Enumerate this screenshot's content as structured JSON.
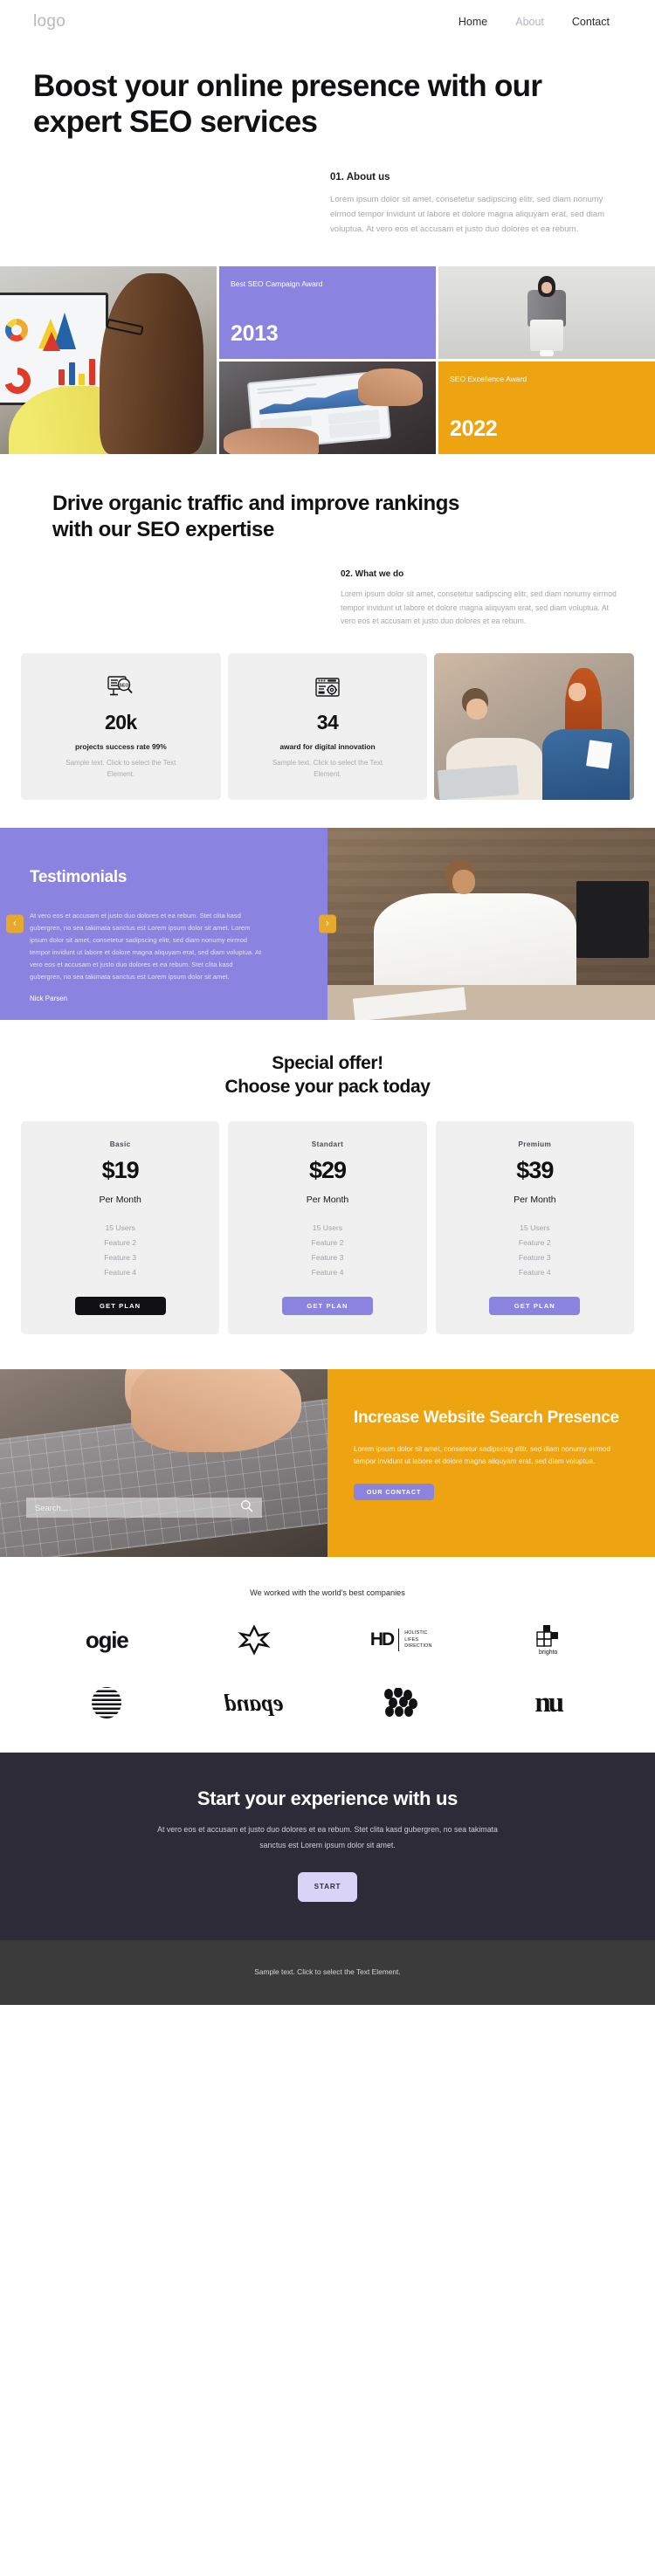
{
  "header": {
    "logo": "logo",
    "nav": [
      {
        "label": "Home",
        "dim": false
      },
      {
        "label": "About",
        "dim": true
      },
      {
        "label": "Contact",
        "dim": false
      }
    ]
  },
  "hero": {
    "heading": "Boost your online presence with our expert SEO services",
    "about_title": "01. About us",
    "about_text": "Lorem ipsum dolor sit amet, consetetur sadipscing elitr, sed diam nonumy eirmod tempor invidunt ut labore et dolore magna aliquyam erat, sed diam voluptua. At vero eos et accusam et justo duo dolores et ea rebum.",
    "awards": [
      {
        "title": "Best SEO Campaign Award",
        "year": "2013",
        "color": "#8b83e0"
      },
      {
        "title": "SEO Excellence Award",
        "year": "2022",
        "color": "#eda410"
      }
    ],
    "photos": [
      "woman-analyzing-charts-on-monitor-photo",
      "woman-standing-grey-jacket-photo",
      "hands-holding-tablet-dashboard-photo"
    ]
  },
  "services": {
    "heading": "Drive organic traffic and improve rankings with our SEO expertise",
    "what_title": "02. What we do",
    "what_text": "Lorem ipsum dolor sit amet, consetetur sadipscing elitr, sed diam nonumy eirmod tempor invidunt ut labore et dolore magna aliquyam erat, sed diam voluptua. At vero eos et accusam et justo duo dolores et ea rebum.",
    "stats": [
      {
        "icon": "seo-search-monitor-icon",
        "number": "20k",
        "label": "projects success rate 99%",
        "sub": "Sample text. Click to select the Text Element."
      },
      {
        "icon": "browser-gear-settings-icon",
        "number": "34",
        "label": "award for digital innovation",
        "sub": "Sample text. Click to select the Text Element."
      }
    ],
    "photo": "two-colleagues-with-laptop-photo"
  },
  "testimonials": {
    "heading": "Testimonials",
    "quote": "At vero eos et accusam et justo duo dolores et ea rebum. Stet clita kasd gubergren, no sea takimata sanctus est Lorem ipsum dolor sit amet. Lorem ipsum dolor sit amet, consetetur sadipscing elitr, sed diam nonumy eirmod tempor invidunt ut labore et dolore magna aliquyam erat, sed diam voluptua. At vero eos et accusam et justo duo dolores et ea rebum. Stet clita kasd gubergren, no sea takimata sanctus est Lorem ipsum dolor sit amet.",
    "author": "Nick Parsen",
    "prev": "‹",
    "next": "›",
    "photo": "man-drinking-coffee-at-desk-photo",
    "bg_color": "#8b83e0",
    "arrow_color": "#e6a92b"
  },
  "pricing": {
    "heading_line1": "Special offer!",
    "heading_line2": "Choose your pack today",
    "plans": [
      {
        "name": "Basic",
        "price": "$19",
        "period": "Per Month",
        "features": [
          "15 Users",
          "Feature 2",
          "Feature 3",
          "Feature 4"
        ],
        "button": "GET PLAN",
        "button_style": "dark"
      },
      {
        "name": "Standart",
        "price": "$29",
        "period": "Per Month",
        "features": [
          "15 Users",
          "Feature 2",
          "Feature 3",
          "Feature 4"
        ],
        "button": "GET PLAN",
        "button_style": "purple"
      },
      {
        "name": "Premium",
        "price": "$39",
        "period": "Per Month",
        "features": [
          "15 Users",
          "Feature 2",
          "Feature 3",
          "Feature 4"
        ],
        "button": "GET PLAN",
        "button_style": "purple"
      }
    ]
  },
  "cta": {
    "photo": "fingers-typing-on-keyboard-photo",
    "search_placeholder": "Search...",
    "search_value": "",
    "search_icon": "magnifier-icon",
    "heading": "Increase Website Search Presence",
    "text": "Lorem ipsum dolor sit amet, consetetur sadipscing elitr, sed diam nonumy eirmod tempor invidunt ut labore et dolore magna aliquyam erat, sed diam voluptua.",
    "button": "OUR CONTACT",
    "bg_color": "#eda410",
    "button_color": "#8b83e0"
  },
  "partners": {
    "caption": "We worked with the world's best companies",
    "logos": [
      {
        "name": "ogie-logo",
        "text": "ogie"
      },
      {
        "name": "flower-asterisk-logo",
        "text": ""
      },
      {
        "name": "hd-holistic-lifes-direction-logo",
        "text": "HD",
        "sub": "HOLISTIC LIFES DIRECTION"
      },
      {
        "name": "brighto-grid-logo",
        "text": "brighto"
      },
      {
        "name": "striped-circle-logo",
        "text": ""
      },
      {
        "name": "epand-script-logo",
        "text": "epand"
      },
      {
        "name": "dots-pattern-logo",
        "text": ""
      },
      {
        "name": "nu-ligature-logo",
        "text": "nu"
      }
    ]
  },
  "footer": {
    "heading": "Start your experience with us",
    "text": "At vero eos et accusam et justo duo dolores et ea rebum. Stet clita kasd gubergren, no sea takimata sanctus est Lorem ipsum dolor sit amet.",
    "button": "START",
    "bottom_text": "Sample text. Click to select the Text Element.",
    "bg_color": "#2e2b39",
    "bar_color": "#3b3b3c"
  }
}
